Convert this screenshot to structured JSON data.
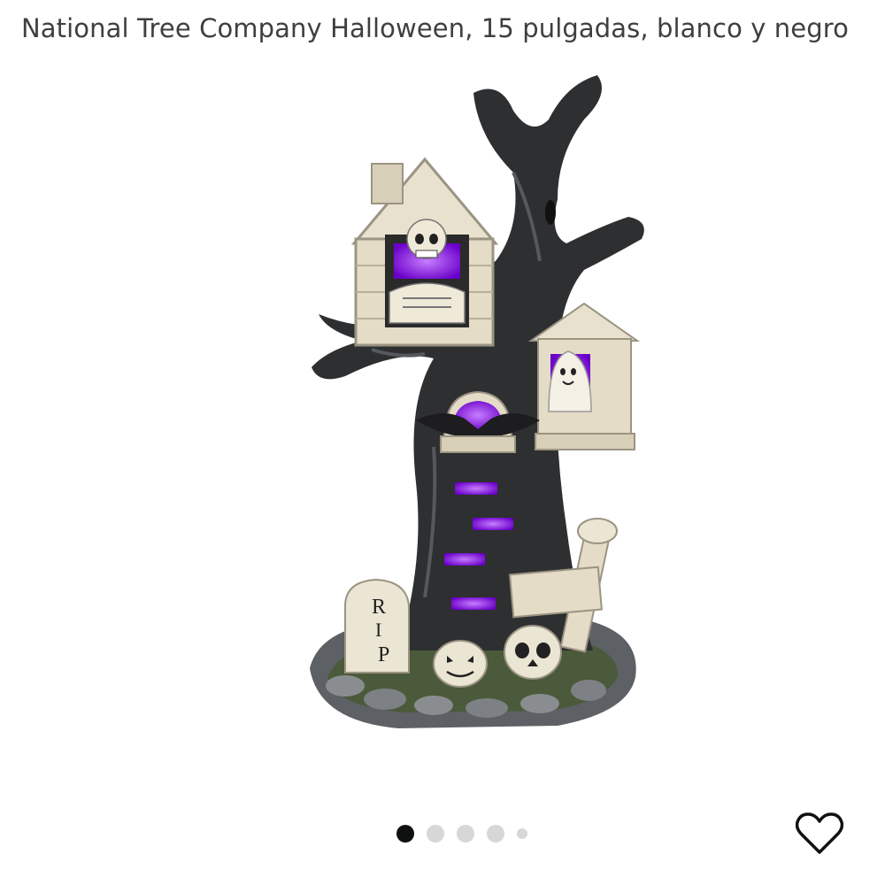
{
  "product": {
    "title": "National Tree Company Halloween, 15 pulgadas, blanco y negro"
  },
  "image": {
    "tombstone_text": [
      "R",
      "I",
      "P"
    ]
  },
  "carousel": {
    "count": 5,
    "active_index": 0
  },
  "icons": {
    "wishlist": "heart-outline-icon"
  },
  "colors": {
    "title": "#3d3f40",
    "dot_active": "#0f1111",
    "dot_inactive": "#d5d7d8",
    "accent_glow": "#8b2be2"
  }
}
